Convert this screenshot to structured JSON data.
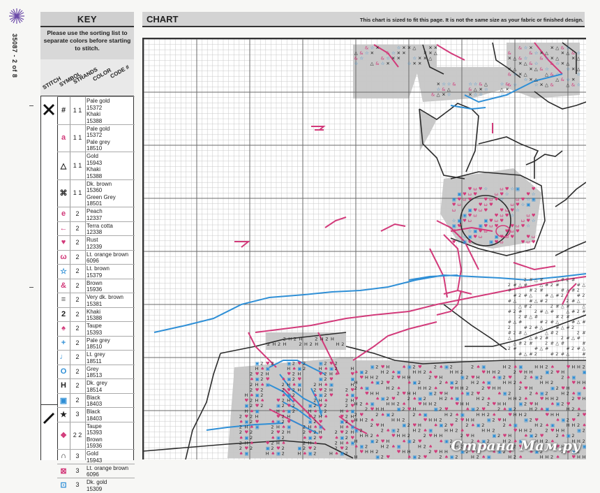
{
  "margin": {
    "page_ref": "35087 - 2 of 8"
  },
  "key": {
    "title": "KEY",
    "note": "Please use the sorting list to separate colors before starting to stitch.",
    "headers": {
      "stitch": "STITCH",
      "symbol": "SYMBOL",
      "strands": "STRANDS",
      "color": "COLOR",
      "code": "CODE #"
    },
    "rows": [
      {
        "symbol": "#",
        "symbol_color": "#222",
        "strands": "1 1",
        "lines": [
          "Pale gold",
          "15372",
          "Khaki",
          "15388"
        ]
      },
      {
        "symbol": "a",
        "symbol_color": "#d23a7a",
        "strands": "1 1",
        "lines": [
          "Pale gold",
          "15372",
          "Pale grey",
          "18510"
        ]
      },
      {
        "symbol": "△",
        "symbol_color": "#222",
        "strands": "1 1",
        "lines": [
          "Gold",
          "15943",
          "Khaki",
          "15388"
        ]
      },
      {
        "symbol": "⌘",
        "symbol_color": "#222",
        "strands": "1 1",
        "lines": [
          "Dk. brown",
          "15360",
          "Green Grey",
          "18501"
        ]
      },
      {
        "symbol": "e",
        "symbol_color": "#d23a7a",
        "strands": "2",
        "lines": [
          "Peach",
          "12337"
        ]
      },
      {
        "symbol": "←",
        "symbol_color": "#d23a7a",
        "strands": "2",
        "lines": [
          "Terra cotta",
          "12338"
        ]
      },
      {
        "symbol": "♥",
        "symbol_color": "#d23a7a",
        "strands": "2",
        "lines": [
          "Rust",
          "12339"
        ]
      },
      {
        "symbol": "ω",
        "symbol_color": "#d23a7a",
        "strands": "2",
        "lines": [
          "Lt. orange brown",
          "6096"
        ]
      },
      {
        "symbol": "☆",
        "symbol_color": "#2f8fd6",
        "strands": "2",
        "lines": [
          "Lt. brown",
          "15379"
        ]
      },
      {
        "symbol": "&",
        "symbol_color": "#d23a7a",
        "strands": "2",
        "lines": [
          "Brown",
          "15936"
        ]
      },
      {
        "symbol": "≡",
        "symbol_color": "#555",
        "strands": "2",
        "lines": [
          "Very dk. brown",
          "15381"
        ]
      },
      {
        "symbol": "2",
        "symbol_color": "#222",
        "strands": "2",
        "lines": [
          "Khaki",
          "15388"
        ]
      },
      {
        "symbol": "♠",
        "symbol_color": "#d23a7a",
        "strands": "2",
        "lines": [
          "Taupe",
          "15393"
        ]
      },
      {
        "symbol": "+",
        "symbol_color": "#2f8fd6",
        "strands": "2",
        "lines": [
          "Pale grey",
          "18510"
        ]
      },
      {
        "symbol": "♩",
        "symbol_color": "#2f8fd6",
        "strands": "2",
        "lines": [
          "Lt. grey",
          "18511"
        ]
      },
      {
        "symbol": "O",
        "symbol_color": "#2f8fd6",
        "strands": "2",
        "lines": [
          "Grey",
          "18513"
        ]
      },
      {
        "symbol": "H",
        "symbol_color": "#222",
        "strands": "2",
        "lines": [
          "Dk. grey",
          "18514"
        ]
      },
      {
        "symbol": "▣",
        "symbol_color": "#2f8fd6",
        "strands": "2",
        "lines": [
          "Black",
          "18403"
        ]
      },
      {
        "symbol": "★",
        "symbol_color": "#222",
        "strands": "3",
        "lines": [
          "Black",
          "18403"
        ]
      },
      {
        "symbol": "❖",
        "symbol_color": "#d23a7a",
        "strands": "2 2",
        "lines": [
          "Taupe",
          "15393",
          "Brown",
          "15936"
        ]
      },
      {
        "symbol": "∩",
        "symbol_color": "#222",
        "strands": "3",
        "lines": [
          "Gold",
          "15943"
        ]
      },
      {
        "symbol": "⊠",
        "symbol_color": "#d23a7a",
        "strands": "3",
        "lines": [
          "Lt. orange brown",
          "6096"
        ]
      },
      {
        "symbol": "⊡",
        "symbol_color": "#2f8fd6",
        "strands": "3",
        "lines": [
          "Dk. gold",
          "15309"
        ]
      }
    ]
  },
  "chart": {
    "title": "CHART",
    "note": "This chart is sized to fit this page. It is not the same size as your fabric or finished design."
  },
  "watermark": "Страна Мам.ру",
  "colors": {
    "pink": "#d23a7a",
    "blue": "#2f8fd6",
    "grey_fill": "#c9c9c9",
    "grid": "#c8c8c8",
    "grid_major": "#6a6a6a"
  }
}
